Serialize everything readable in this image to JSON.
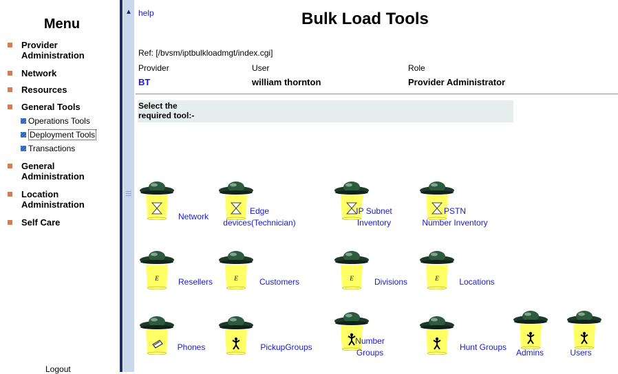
{
  "menu": {
    "title": "Menu",
    "items": [
      {
        "label": "Provider\nAdministration"
      },
      {
        "label": "Network"
      },
      {
        "label": "Resources"
      },
      {
        "label": "General Tools"
      },
      {
        "label": "General\nAdministration"
      },
      {
        "label": "Location\nAdministration"
      },
      {
        "label": "Self Care"
      }
    ],
    "subitems": [
      {
        "label": "Operations Tools"
      },
      {
        "label": "Deployment Tools",
        "selected": true
      },
      {
        "label": "Transactions"
      }
    ],
    "logout": "Logout"
  },
  "header": {
    "help": "help",
    "title": "Bulk Load Tools",
    "ref": "Ref: [/bvsm/iptbulkloadmgt/index.cgi]",
    "provider_label": "Provider",
    "user_label": "User",
    "role_label": "Role",
    "provider_value": "BT",
    "user_value": "william thornton",
    "role_value": "Provider Administrator"
  },
  "select_prompt": "Select the\nrequired tool:-",
  "tools": [
    {
      "label": "Network",
      "glyph": "hourglass-icon"
    },
    {
      "label": "Edge\ndevices(Technician)",
      "glyph": "hourglass-icon"
    },
    {
      "label": "IP Subnet\nInventory",
      "glyph": "hourglass-icon"
    },
    {
      "label": "PSTN\nNumber Inventory",
      "glyph": "hourglass-icon"
    },
    {
      "label": "Resellers",
      "glyph": "letter-icon"
    },
    {
      "label": "Customers",
      "glyph": "letter-icon"
    },
    {
      "label": "Divisions",
      "glyph": "letter-icon"
    },
    {
      "label": "Locations",
      "glyph": "letter-icon"
    },
    {
      "label": "Phones",
      "glyph": "phone-icon"
    },
    {
      "label": "PickupGroups",
      "glyph": "person-icon"
    },
    {
      "label": "Number\nGroups",
      "glyph": "person-icon"
    },
    {
      "label": "Hunt Groups",
      "glyph": "person-icon"
    },
    {
      "label": "Admins",
      "glyph": "person-icon"
    },
    {
      "label": "Users",
      "glyph": "person-icon"
    }
  ],
  "colors": {
    "menu_bullet": "#e07a4c",
    "submenu_bullet": "#2a5db0",
    "link": "#1a1ad0",
    "ufo_beam": "#ffff66",
    "ufo_dark": "#1e3a2a",
    "select_bg": "#e6eded"
  }
}
